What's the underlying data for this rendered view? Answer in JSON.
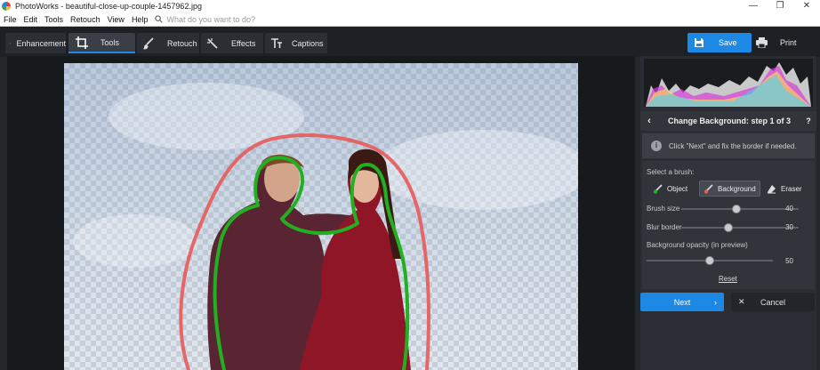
{
  "window": {
    "title": "PhotoWorks - beautiful-close-up-couple-1457962.jpg",
    "controls": {
      "minimize": "—",
      "maximize": "❐",
      "close": "✕"
    }
  },
  "menu": {
    "items": [
      "File",
      "Edit",
      "Tools",
      "Retouch",
      "View",
      "Help"
    ],
    "search_placeholder": "What do you want to do?"
  },
  "toolbar": {
    "tabs": [
      {
        "label": "Enhancement",
        "icon": "sliders-icon"
      },
      {
        "label": "Tools",
        "icon": "crop-icon",
        "active": true
      },
      {
        "label": "Retouch",
        "icon": "brush-icon"
      },
      {
        "label": "Effects",
        "icon": "magic-wand-icon"
      },
      {
        "label": "Captions",
        "icon": "text-icon"
      }
    ],
    "save_label": "Save",
    "print_label": "Print"
  },
  "panel": {
    "step_title": "Change Background: step 1 of 3",
    "help_label": "?",
    "hint": "Click \"Next\" and fix the border if needed.",
    "brush_label": "Select a brush:",
    "brushes": [
      {
        "label": "Object",
        "icon": "object-brush-icon"
      },
      {
        "label": "Background",
        "icon": "background-brush-icon",
        "selected": true
      },
      {
        "label": "Eraser",
        "icon": "eraser-icon"
      }
    ],
    "sliders": [
      {
        "label": "Brush size",
        "value": "40",
        "level": 0.47
      },
      {
        "label": "Blur border",
        "value": "30",
        "level": 0.4
      },
      {
        "label": "Background opacity (in preview)",
        "value": "50",
        "level": 0.5
      }
    ],
    "reset_label": "Reset",
    "next_label": "Next",
    "cancel_label": "Cancel"
  },
  "colors": {
    "accent": "#1e88e5",
    "object_stroke": "#22b022",
    "background_stroke": "#e85a5a"
  }
}
